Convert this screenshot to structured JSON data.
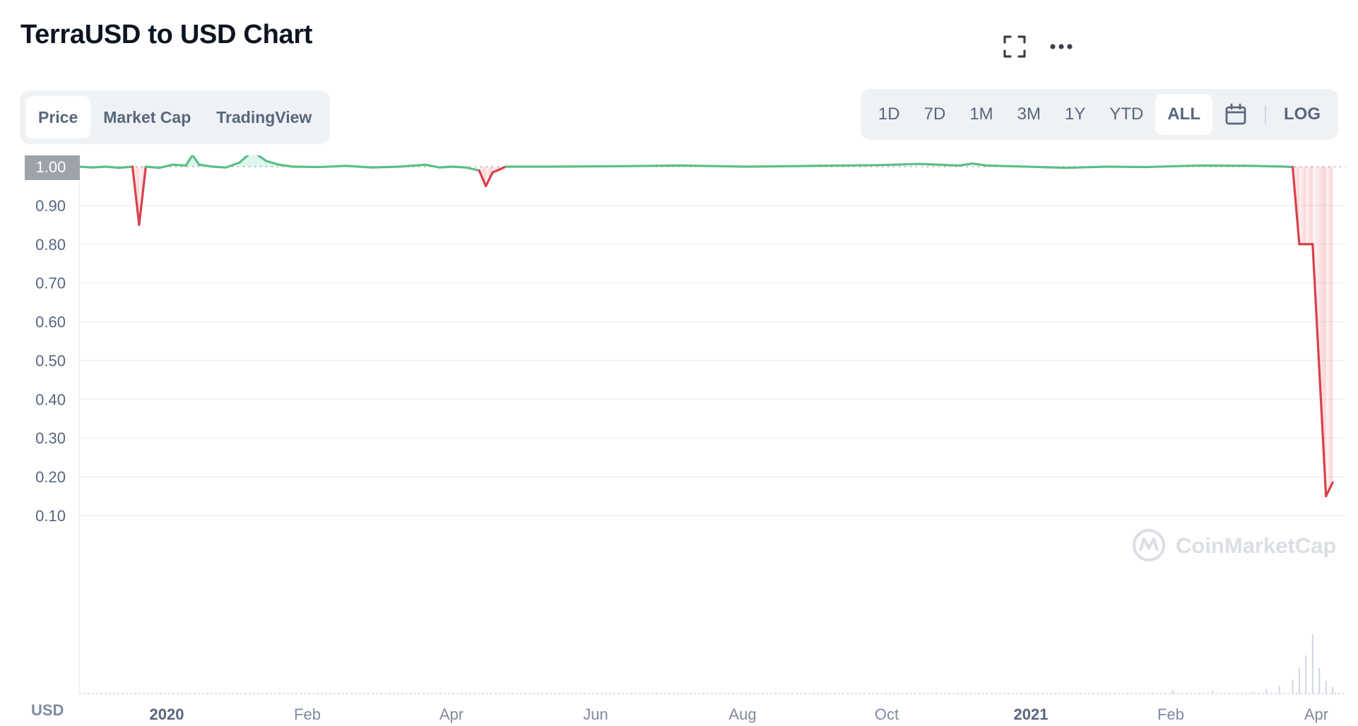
{
  "header": {
    "title": "TerraUSD to USD Chart"
  },
  "view_tabs": [
    {
      "label": "Price",
      "active": true
    },
    {
      "label": "Market Cap",
      "active": false
    },
    {
      "label": "TradingView",
      "active": false
    }
  ],
  "ranges": [
    {
      "label": "1D",
      "active": false
    },
    {
      "label": "7D",
      "active": false
    },
    {
      "label": "1M",
      "active": false
    },
    {
      "label": "3M",
      "active": false
    },
    {
      "label": "1Y",
      "active": false
    },
    {
      "label": "YTD",
      "active": false
    },
    {
      "label": "ALL",
      "active": true
    }
  ],
  "log_label": "LOG",
  "icons": {
    "fullscreen": "fullscreen-icon",
    "more": "more-options-icon",
    "calendar": "calendar-icon"
  },
  "watermark": "CoinMarketCap",
  "colors": {
    "up": "#16c784",
    "down": "#ea3943",
    "line_up": "#5bbf86",
    "line_down": "#d9404a",
    "text_muted": "#58667e",
    "current_price_badge": "#9ea3ab"
  },
  "chart_data": {
    "type": "line",
    "current_price_label": "1.00",
    "unit_label": "USD",
    "y_ticks": [
      "1.00",
      "0.90",
      "0.80",
      "0.70",
      "0.60",
      "0.50",
      "0.40",
      "0.30",
      "0.20",
      "0.10"
    ],
    "ylim": [
      0.0,
      1.05
    ],
    "x_ticks": [
      "2020",
      "Feb",
      "Apr",
      "Jun",
      "Aug",
      "Oct",
      "2021",
      "Feb",
      "Apr"
    ],
    "x_tick_bold": [
      true,
      false,
      false,
      false,
      false,
      false,
      true,
      false,
      false
    ],
    "grid": true,
    "series": [
      {
        "values": [
          [
            0,
            1.0
          ],
          [
            1,
            0.998
          ],
          [
            2,
            1.0
          ],
          [
            3,
            0.997
          ],
          [
            4,
            1.0
          ],
          [
            4.5,
            0.85
          ],
          [
            5,
            1.0
          ],
          [
            6,
            0.997
          ],
          [
            7,
            1.005
          ],
          [
            8,
            1.003
          ],
          [
            8.5,
            1.03
          ],
          [
            9,
            1.005
          ],
          [
            10,
            1.0
          ],
          [
            11,
            0.998
          ],
          [
            12,
            1.01
          ],
          [
            13,
            1.04
          ],
          [
            14,
            1.015
          ],
          [
            15,
            1.005
          ],
          [
            16,
            1.0
          ],
          [
            18,
            0.999
          ],
          [
            20,
            1.002
          ],
          [
            22,
            0.998
          ],
          [
            24,
            1.0
          ],
          [
            26,
            1.005
          ],
          [
            27,
            0.998
          ],
          [
            28,
            1.0
          ],
          [
            29,
            0.998
          ],
          [
            30,
            0.99
          ],
          [
            30.5,
            0.95
          ],
          [
            31,
            0.985
          ],
          [
            32,
            1.0
          ],
          [
            35,
            1.0
          ],
          [
            40,
            1.001
          ],
          [
            45,
            1.003
          ],
          [
            50,
            1.0
          ],
          [
            55,
            1.002
          ],
          [
            60,
            1.004
          ],
          [
            63,
            1.007
          ],
          [
            66,
            1.003
          ],
          [
            67,
            1.008
          ],
          [
            68,
            1.003
          ],
          [
            70,
            1.001
          ],
          [
            74,
            0.997
          ],
          [
            77,
            1.0
          ],
          [
            80,
            0.999
          ],
          [
            84,
            1.003
          ],
          [
            88,
            1.002
          ],
          [
            90.5,
            1.0
          ],
          [
            91,
            0.999
          ],
          [
            91.5,
            0.8
          ],
          [
            92,
            0.8
          ],
          [
            92.5,
            0.8
          ],
          [
            93.5,
            0.15
          ],
          [
            94,
            0.185
          ]
        ]
      }
    ],
    "volume": [
      [
        82,
        0.4
      ],
      [
        85,
        0.3
      ],
      [
        88,
        0.2
      ],
      [
        89,
        0.5
      ],
      [
        90,
        0.9
      ],
      [
        91,
        1.6
      ],
      [
        91.5,
        3.0
      ],
      [
        92,
        4.5
      ],
      [
        92.5,
        7.0
      ],
      [
        93,
        3.0
      ],
      [
        93.5,
        1.5
      ],
      [
        94,
        0.8
      ]
    ]
  }
}
